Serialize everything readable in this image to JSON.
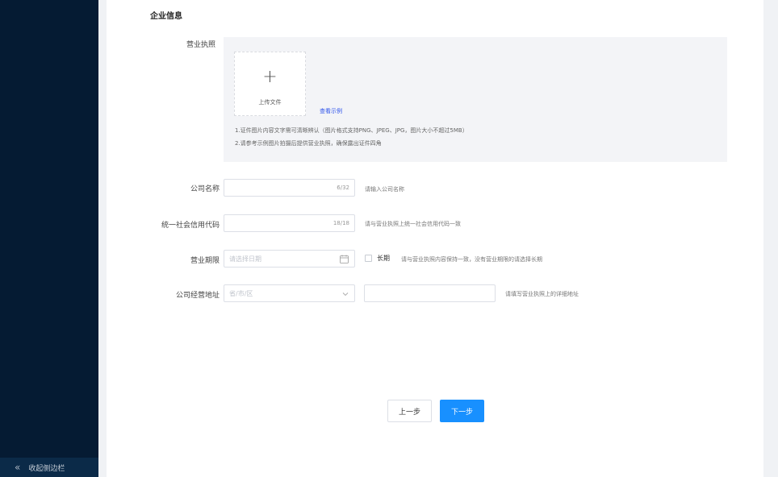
{
  "sidebar": {
    "collapse_label": "收起侧边栏"
  },
  "section": {
    "title": "企业信息"
  },
  "license": {
    "label": "营业执照",
    "upload_label": "上传文件",
    "view_example": "查看示例",
    "hint_1": "1.证件图片内容文字需可清晰辨认（图片格式支持PNG、JPEG、JPG，图片大小不超过5MB）",
    "hint_2": "2.请参考示例图片拍摄后提供营业执照，确保露出证件四角"
  },
  "company_name": {
    "label": "公司名称",
    "counter": "6/32",
    "hint": "请输入公司名称"
  },
  "credit_code": {
    "label": "统一社会信用代码",
    "counter": "18/18",
    "hint": "请与营业执照上统一社会信用代码一致"
  },
  "business_term": {
    "label": "营业期限",
    "placeholder": "请选择日期",
    "long_term_label": "长期",
    "hint": "请与营业执照内容保持一致，没有营业期限的请选择长期"
  },
  "address": {
    "label": "公司经营地址",
    "region_placeholder": "省/市/区",
    "hint": "请填写营业执照上的详细地址"
  },
  "buttons": {
    "prev": "上一步",
    "next": "下一步"
  },
  "colors": {
    "sidebar_bg": "#051b33",
    "primary": "#1890ff",
    "link": "#2f54eb"
  },
  "icons": {
    "collapse": "double-chevron-left-icon",
    "upload": "plus-icon",
    "date": "calendar-icon",
    "select": "chevron-down-icon"
  }
}
